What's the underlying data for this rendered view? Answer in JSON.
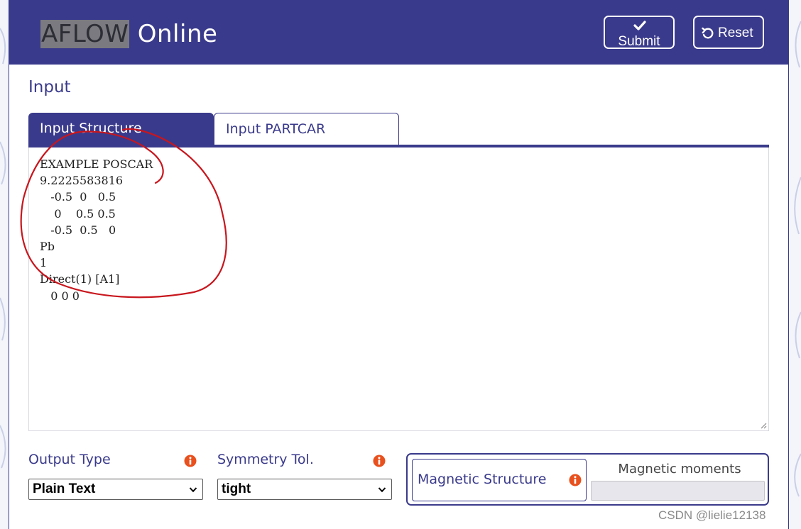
{
  "header": {
    "brand_highlight": "AFLOW",
    "brand_rest": " Online",
    "submit_label": "Submit",
    "reset_label": "Reset",
    "color": "#3a3a8c"
  },
  "input_section": {
    "title": "Input",
    "tabs": [
      {
        "label": "Input Structure",
        "active": true
      },
      {
        "label": "Input PARTCAR",
        "active": false
      }
    ],
    "structure_text": "EXAMPLE POSCAR\n9.2225583816\n   -0.5  0   0.5\n    0    0.5 0.5\n   -0.5  0.5   0\nPb\n1\nDirect(1) [A1]\n   0 0 0"
  },
  "options": {
    "output_type": {
      "label": "Output Type",
      "selected": "Plain Text"
    },
    "symmetry_tol": {
      "label": "Symmetry Tol.",
      "selected": "tight"
    },
    "magnetic_structure": {
      "label": "Magnetic Structure",
      "moments_label": "Magnetic moments",
      "moments_value": ""
    }
  },
  "watermark": "CSDN @lielie12138",
  "annotation_color": "#c8161d",
  "info_icon_color": "#e8501d"
}
